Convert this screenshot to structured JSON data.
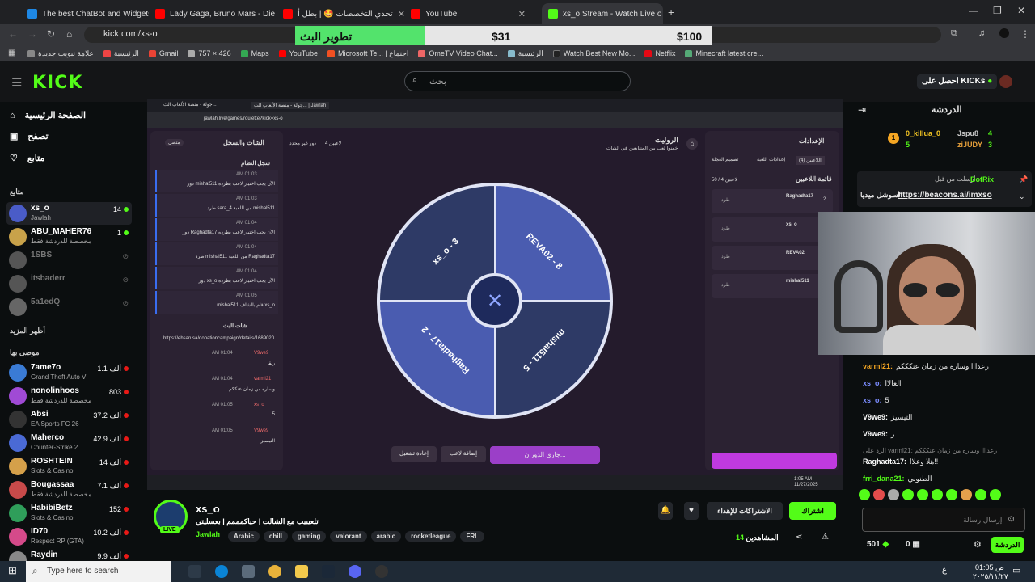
{
  "browser": {
    "tabs": [
      {
        "title": "The best ChatBot and Widgets",
        "color": "#1e88e5"
      },
      {
        "title": "Lady Gaga, Bruno Mars - Die W",
        "color": "#ff0000"
      },
      {
        "title": "تحدي التخصصات 🤩 | بطل أ",
        "color": "#ff0000"
      },
      {
        "title": "YouTube",
        "color": "#ff0000"
      },
      {
        "title": "xs_o Stream - Watch Live o",
        "color": "#53fc18"
      }
    ],
    "url": "kick.com/xs-o",
    "bookmarks": [
      "علامة تبويب جديدة",
      "الرئيسية",
      "Gmail",
      "757 × 426",
      "Maps",
      "YouTube",
      "Microsoft Te... | اجتماع",
      "OmeTV Video Chat...",
      "الرئيسية",
      "Watch Best New Mo...",
      "Netflix",
      "Minecraft latest cre..."
    ]
  },
  "goal": {
    "title": "تطوير البث",
    "current": "$31",
    "target": "$100",
    "progress": 0.31,
    "color": "#53e36c"
  },
  "kick": {
    "logo": "KICK",
    "search_placeholder": "بحث",
    "get_kicks": "احصل على KICKs",
    "accent": "#53fc18"
  },
  "sidebar": {
    "nav": [
      {
        "label": "الصفحة الرئيسية",
        "icon": "home-icon"
      },
      {
        "label": "تصفح",
        "icon": "browse-icon"
      },
      {
        "label": "متابع",
        "icon": "heart-icon"
      }
    ],
    "following_header": "متابع",
    "following": [
      {
        "name": "xs_o",
        "cat": "Jawlah",
        "viewers": "14",
        "live": true,
        "color": "#4a5cc8"
      },
      {
        "name": "ABU_MAHER76",
        "cat": "مخصصة للدردشة فقط",
        "viewers": "1",
        "live": true,
        "color": "#c8a24a"
      },
      {
        "name": "1SBS",
        "cat": "",
        "viewers": "",
        "live": false,
        "color": "#555"
      },
      {
        "name": "itsbaderr",
        "cat": "",
        "viewers": "",
        "live": false,
        "color": "#555"
      },
      {
        "name": "5a1edQ",
        "cat": "",
        "viewers": "",
        "live": false,
        "color": "#666"
      }
    ],
    "show_more": "أظهر المزيد",
    "recommended_header": "موصى بها",
    "recommended": [
      {
        "name": "7ame7o",
        "cat": "Grand Theft Auto V",
        "viewers": "1.1 ألف",
        "color": "#3a7bd5"
      },
      {
        "name": "nonolinhoos",
        "cat": "مخصصة للدردشة فقط",
        "viewers": "803",
        "color": "#a04ad5"
      },
      {
        "name": "Absi",
        "cat": "EA Sports FC 26",
        "viewers": "37.2 ألف",
        "color": "#333"
      },
      {
        "name": "Maherco",
        "cat": "Counter-Strike 2",
        "viewers": "42.9 ألف",
        "color": "#4a6ad5"
      },
      {
        "name": "ROSHTEIN",
        "cat": "Slots & Casino",
        "viewers": "14 ألف",
        "color": "#d5a04a"
      },
      {
        "name": "Bougassaa",
        "cat": "مخصصة للدردشة فقط",
        "viewers": "7.1 ألف",
        "color": "#c84a4a"
      },
      {
        "name": "HabibiBetz",
        "cat": "Slots & Casino",
        "viewers": "152",
        "color": "#2f9e5a"
      },
      {
        "name": "ID70",
        "cat": "Respect RP (GTA)",
        "viewers": "10.2 ألف",
        "color": "#d54a8a"
      },
      {
        "name": "Raydin",
        "cat": "",
        "viewers": "9.9 ألف",
        "color": "#888"
      }
    ]
  },
  "stream_app": {
    "tab1": "جولة - منصة الألعاب الت...",
    "tab2": "جولة - منصة الألعاب الت... | Jawlah",
    "url": "jawlah.live/games/roulette?kick=xs-o",
    "chat_log_title": "الشات والسجل",
    "connected": "متصل",
    "system_log": "سجل النظام",
    "logs": [
      {
        "time": "AM 01:03",
        "text": "دور mishal511 الآن يجب اختيار لاعب بطرده"
      },
      {
        "time": "AM 01:03",
        "text": "طرد sara_4 من اللعبة mishal511"
      },
      {
        "time": "AM 01:04",
        "text": "دور Raghadta17 الآن يجب اختيار لاعب بطرده"
      },
      {
        "time": "AM 01:04",
        "text": "طرد mishal511 من اللعبة Raghadta17"
      },
      {
        "time": "AM 01:04",
        "text": "دور xs_o الآن يجب اختيار لاعب بطرده"
      },
      {
        "time": "AM 01:05",
        "text": "mishal511 قام بالشاف xs_o"
      }
    ],
    "live_chat_title": "شات البث",
    "donation_url": "https://ehsan.sa/donationcampaign/details/1689020",
    "live_chat": [
      {
        "user": "V9we9",
        "text": "ريقا",
        "time": "AM 01:04"
      },
      {
        "user": "varml21",
        "text": "وساره من زمان عنككم",
        "time": "AM 01:04"
      },
      {
        "user": "xs_o",
        "text": "5",
        "time": "AM 01:05"
      },
      {
        "user": "V9we9",
        "text": "التيسيز",
        "time": "AM 01:05"
      }
    ],
    "game_title": "الروليت",
    "game_subtitle": "خمنوا لعب بين المتنابعين في الشات",
    "players_count": "4 لاعبين",
    "round": "دور غير محدد",
    "wheel": [
      {
        "label": "REVA02 - 8",
        "color": "#4a5cb0"
      },
      {
        "label": "mishal511 - 5",
        "color": "#2e3a66"
      },
      {
        "label": "Raghadta17 - 2",
        "color": "#4a5cb0"
      },
      {
        "label": "xs_o - 3",
        "color": "#2e3a66"
      }
    ],
    "btn_reset": "إعادة تشغيل",
    "btn_add": "إضافة لاعب",
    "btn_spin": "جاري الدوران...",
    "settings_title": "الإعدادات",
    "settings_tabs": [
      "اللاعبين (4)",
      "إعدادات اللعبة",
      "تصميم العجلة"
    ],
    "players_list_title": "قائمة اللاعبين",
    "players_limit": "50 / 4 لاعبين",
    "players": [
      {
        "name": "Raghadta17",
        "num": "2"
      },
      {
        "name": "xs_o",
        "num": ""
      },
      {
        "name": "REVA02",
        "num": ""
      },
      {
        "name": "mishal511",
        "num": ""
      }
    ],
    "kick_btn": "طرد",
    "clock": "1:05 AM",
    "date": "11/27/2025"
  },
  "stream_info": {
    "channel": "xs_o",
    "live": "LIVE",
    "title": "تلعيبيب مع الشالت | حياكمممم | بعسليتي",
    "category": "Jawlah",
    "tags": [
      "Arabic",
      "chill",
      "gaming",
      "valorant",
      "arabic",
      "rocketleague",
      "FRL"
    ],
    "subscribe": "اشتراك",
    "gift_subs": "الاشتراكات للإهداء",
    "viewers": "14",
    "viewers_label": "المشاهدين"
  },
  "chat": {
    "title": "الدردشة",
    "leaders": [
      {
        "name": "0_killua_0",
        "count": "5",
        "rank": "1"
      },
      {
        "name": "Jspu8",
        "count": "4"
      },
      {
        "name": "ziJUDY",
        "count": "3"
      }
    ],
    "sent_by": "أرسلت من قبل",
    "bot": "BotRix",
    "pinned_label": "السوشل ميديا",
    "pinned_link": "https://beacons.ai/imxso",
    "messages": [
      {
        "user": "varml21:",
        "text": "رعدااا وساره من زمان عنكككم",
        "color": "#f5a623"
      },
      {
        "user": "xs_o:",
        "text": "العالاا",
        "color": "#7b8cff"
      },
      {
        "user": "xs_o:",
        "text": "5",
        "color": "#7b8cff"
      },
      {
        "user": "V9we9:",
        "text": "التيسيز",
        "color": "#ffffff"
      },
      {
        "user": "V9we9:",
        "text": "ر",
        "color": "#ffffff"
      },
      {
        "user": "Raghadta17:",
        "text": "هلا وعلاا!!",
        "color": "#ffffff",
        "reply": "الرد على varml21: رعدااا وساره من زمان عنكككم"
      },
      {
        "user": "frri_dana21:",
        "text": "الطنوني",
        "color": "#53fc18"
      }
    ],
    "input_placeholder": "إرسال رسالة",
    "points": "501",
    "zero": "0",
    "send": "الدردشة"
  },
  "taskbar": {
    "search_placeholder": "Type here to search",
    "time": "01:05 ص",
    "date": "٢٠٢٥/١١/٢٧",
    "lang": "ع"
  }
}
